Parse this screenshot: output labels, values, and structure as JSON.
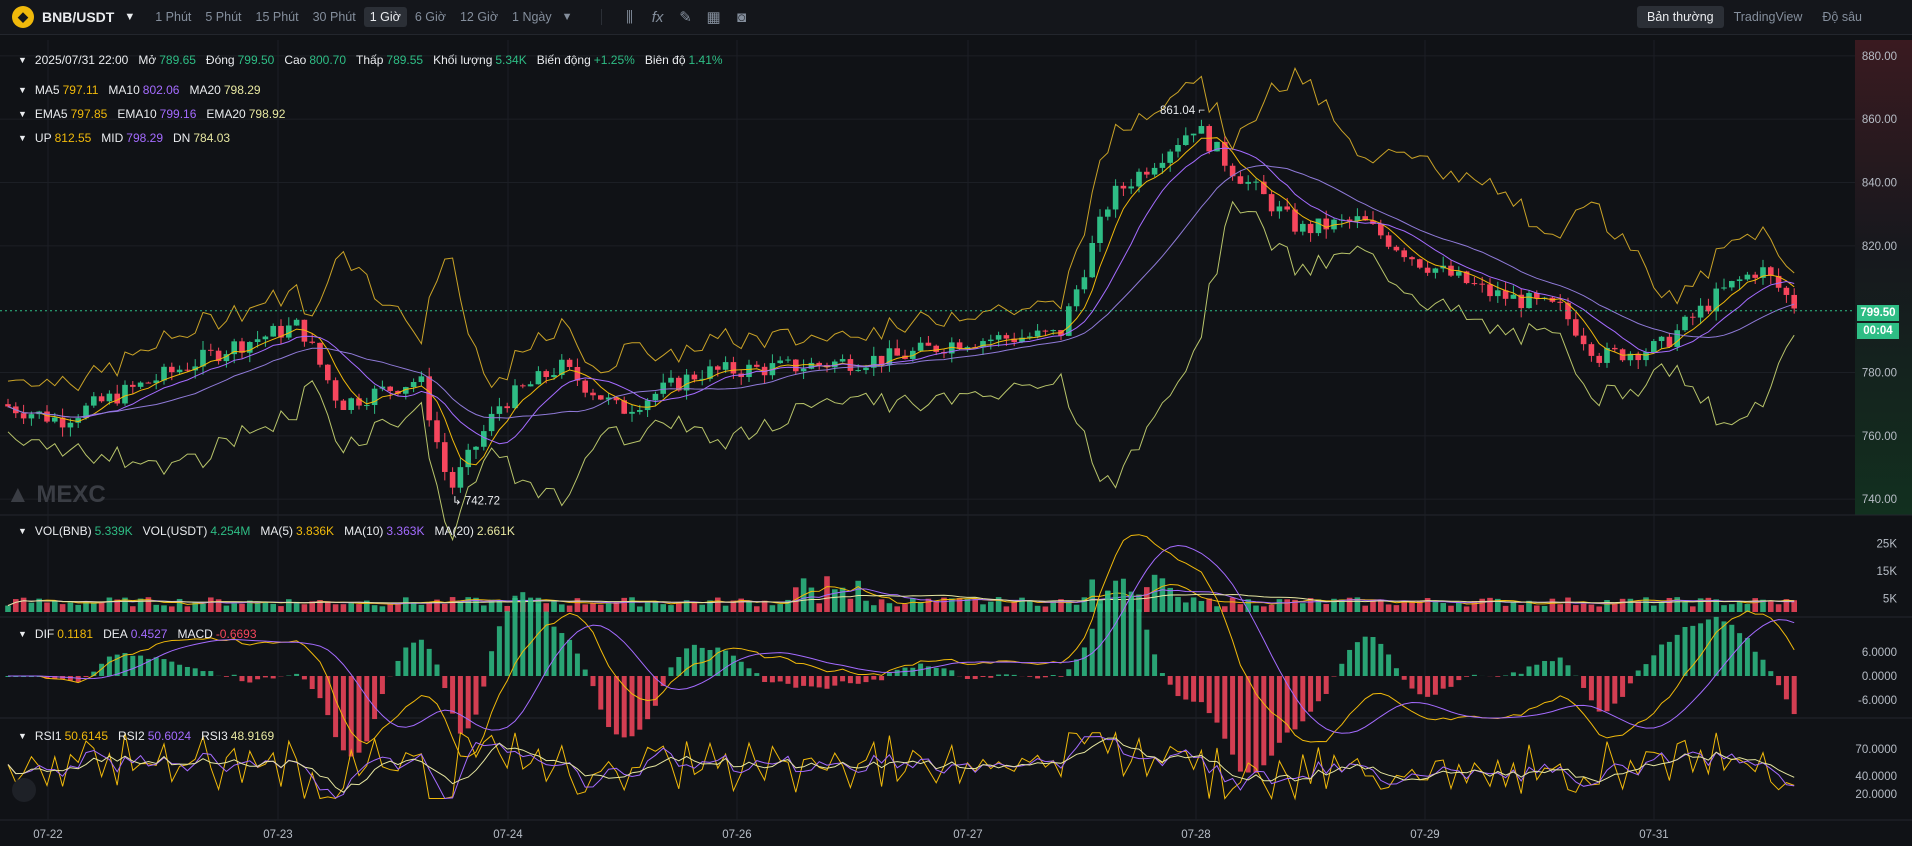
{
  "toolbar": {
    "symbol": "BNB/USDT",
    "intervals": [
      "1 Phút",
      "5 Phút",
      "15 Phút",
      "30 Phút",
      "1 Giờ",
      "6 Giờ",
      "12 Giờ",
      "1 Ngày"
    ],
    "active_interval": "1 Giờ",
    "modes": [
      "Bản thường",
      "TradingView",
      "Độ sâu"
    ],
    "active_mode": "Bản thường"
  },
  "ohlc": {
    "date": "2025/07/31 22:00",
    "open_label": "Mở",
    "open": "789.65",
    "close_label": "Đóng",
    "close": "799.50",
    "high_label": "Cao",
    "high": "800.70",
    "low_label": "Thấp",
    "low": "789.55",
    "volume_label": "Khối lượng",
    "volume": "5.34K",
    "change_label": "Biến động",
    "change": "+1.25%",
    "amplitude_label": "Biên độ",
    "amplitude": "1.41%"
  },
  "ma": {
    "ma5": "797.11",
    "ma10": "802.06",
    "ma20": "798.29"
  },
  "ema": {
    "ema5": "797.85",
    "ema10": "799.16",
    "ema20": "798.92"
  },
  "boll": {
    "up": "812.55",
    "mid": "798.29",
    "dn": "784.03"
  },
  "vol": {
    "vol_bnb": "5.339K",
    "vol_usdt": "4.254M",
    "ma5": "3.836K",
    "ma10": "3.363K",
    "ma20": "2.661K"
  },
  "macd": {
    "dif": "0.1181",
    "dea": "0.4527",
    "macd": "-0.6693"
  },
  "rsi": {
    "rsi1": "50.6145",
    "rsi2": "50.6024",
    "rsi3": "48.9169"
  },
  "price_axis": [
    "880.00",
    "860.00",
    "840.00",
    "820.00",
    "780.00",
    "760.00",
    "740.00"
  ],
  "vol_axis": [
    "25K",
    "15K",
    "5K"
  ],
  "macd_axis": [
    "6.0000",
    "0.0000",
    "-6.0000"
  ],
  "rsi_axis": [
    "70.0000",
    "40.0000",
    "20.0000"
  ],
  "dates": [
    "07-22",
    "07-23",
    "07-24",
    "07-26",
    "07-27",
    "07-28",
    "07-29",
    "07-31"
  ],
  "current_price": "799.50",
  "countdown": "00:04",
  "high_marker": "861.04",
  "low_marker": "742.72",
  "watermark": "MEXC",
  "colors": {
    "up": "#2ebd85",
    "down": "#f6465d",
    "ma5": "#f0b90b",
    "ma10": "#a46bff",
    "ma20": "#e6e6a0",
    "bg": "#101216"
  },
  "chart_data": {
    "type": "candlestick",
    "interval": "1h",
    "ylim": [
      735,
      885
    ],
    "key_points": [
      {
        "x": "07-22",
        "y": 770
      },
      {
        "x": "07-23",
        "y": 795
      },
      {
        "x": "07-23",
        "y": 742.72
      },
      {
        "x": "07-24",
        "y": 770
      },
      {
        "x": "07-26",
        "y": 785
      },
      {
        "x": "07-27",
        "y": 790
      },
      {
        "x": "07-28",
        "y": 861.04
      },
      {
        "x": "07-29",
        "y": 800
      },
      {
        "x": "07-31",
        "y": 780
      },
      {
        "x": "07-31",
        "y": 813
      },
      {
        "x": "07-31",
        "y": 799.5
      }
    ]
  }
}
